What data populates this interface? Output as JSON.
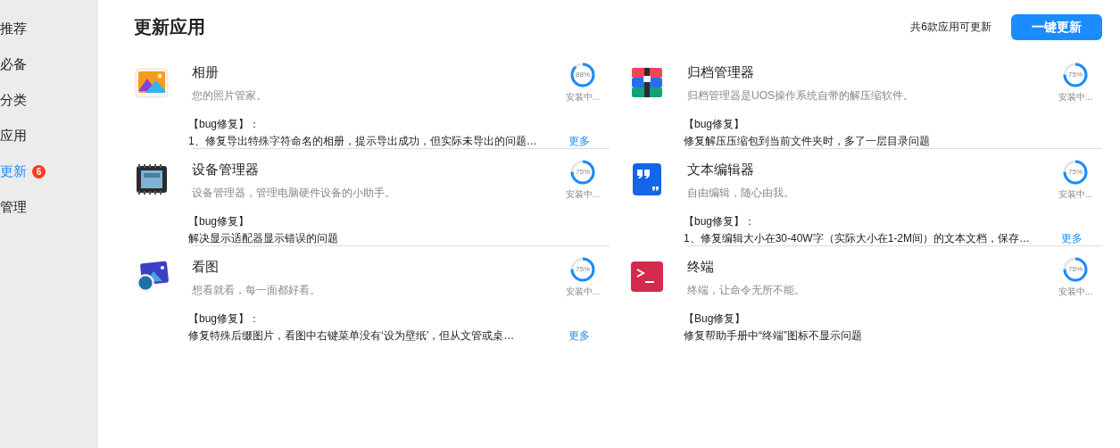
{
  "sidebar": {
    "items": [
      {
        "label": "推荐",
        "selected": false
      },
      {
        "label": "必备",
        "selected": false
      },
      {
        "label": "分类",
        "selected": false
      },
      {
        "label": "应用",
        "selected": false
      },
      {
        "label": "更新",
        "selected": true,
        "badge": "6"
      },
      {
        "label": "管理",
        "selected": false
      }
    ]
  },
  "header": {
    "title": "更新应用",
    "count": "共6款应用可更新",
    "button": "一键更新"
  },
  "apps": [
    {
      "kind": "album",
      "name": "相册",
      "description": "您的照片管家。",
      "note_title": "【bug修复】：",
      "note": "1、修复导出特殊字符命名的相册，提示导出成功，但实际未导出的问题…",
      "percent": "88%",
      "status": "安装中...",
      "more": "更多"
    },
    {
      "kind": "archive",
      "name": "归档管理器",
      "description": "归档管理器是UOS操作系统自带的解压缩软件。",
      "note_title": "【bug修复】",
      "note": "修复解压压缩包到当前文件夹时，多了一层目录问题",
      "percent": "75%",
      "status": "安装中..."
    },
    {
      "kind": "device",
      "name": "设备管理器",
      "description": "设备管理器，管理电脑硬件设备的小助手。",
      "note_title": "【bug修复】",
      "note": "解决显示适配器显示错误的问题",
      "percent": "75%",
      "status": "安装中..."
    },
    {
      "kind": "editor",
      "name": "文本编辑器",
      "description": "自由编辑，随心由我。",
      "note_title": "【bug修复】：",
      "note": "1、修复编辑大小在30-40W字（实际大小在1-2M间）的文本文档，保存…",
      "percent": "75%",
      "status": "安装中...",
      "more": "更多"
    },
    {
      "kind": "viewer",
      "name": "看图",
      "description": "想看就看，每一面都好看。",
      "note_title": "【bug修复】：",
      "note": "修复特殊后缀图片，看图中右键菜单没有‘设为壁纸’，但从文管或桌…",
      "percent": "75%",
      "status": "安装中...",
      "more": "更多"
    },
    {
      "kind": "terminal",
      "name": "终端",
      "description": "终端，让命令无所不能。",
      "note_title": "【Bug修复】",
      "note": "修复帮助手册中“终端”图标不显示问题",
      "percent": "75%",
      "status": "安装中..."
    }
  ]
}
